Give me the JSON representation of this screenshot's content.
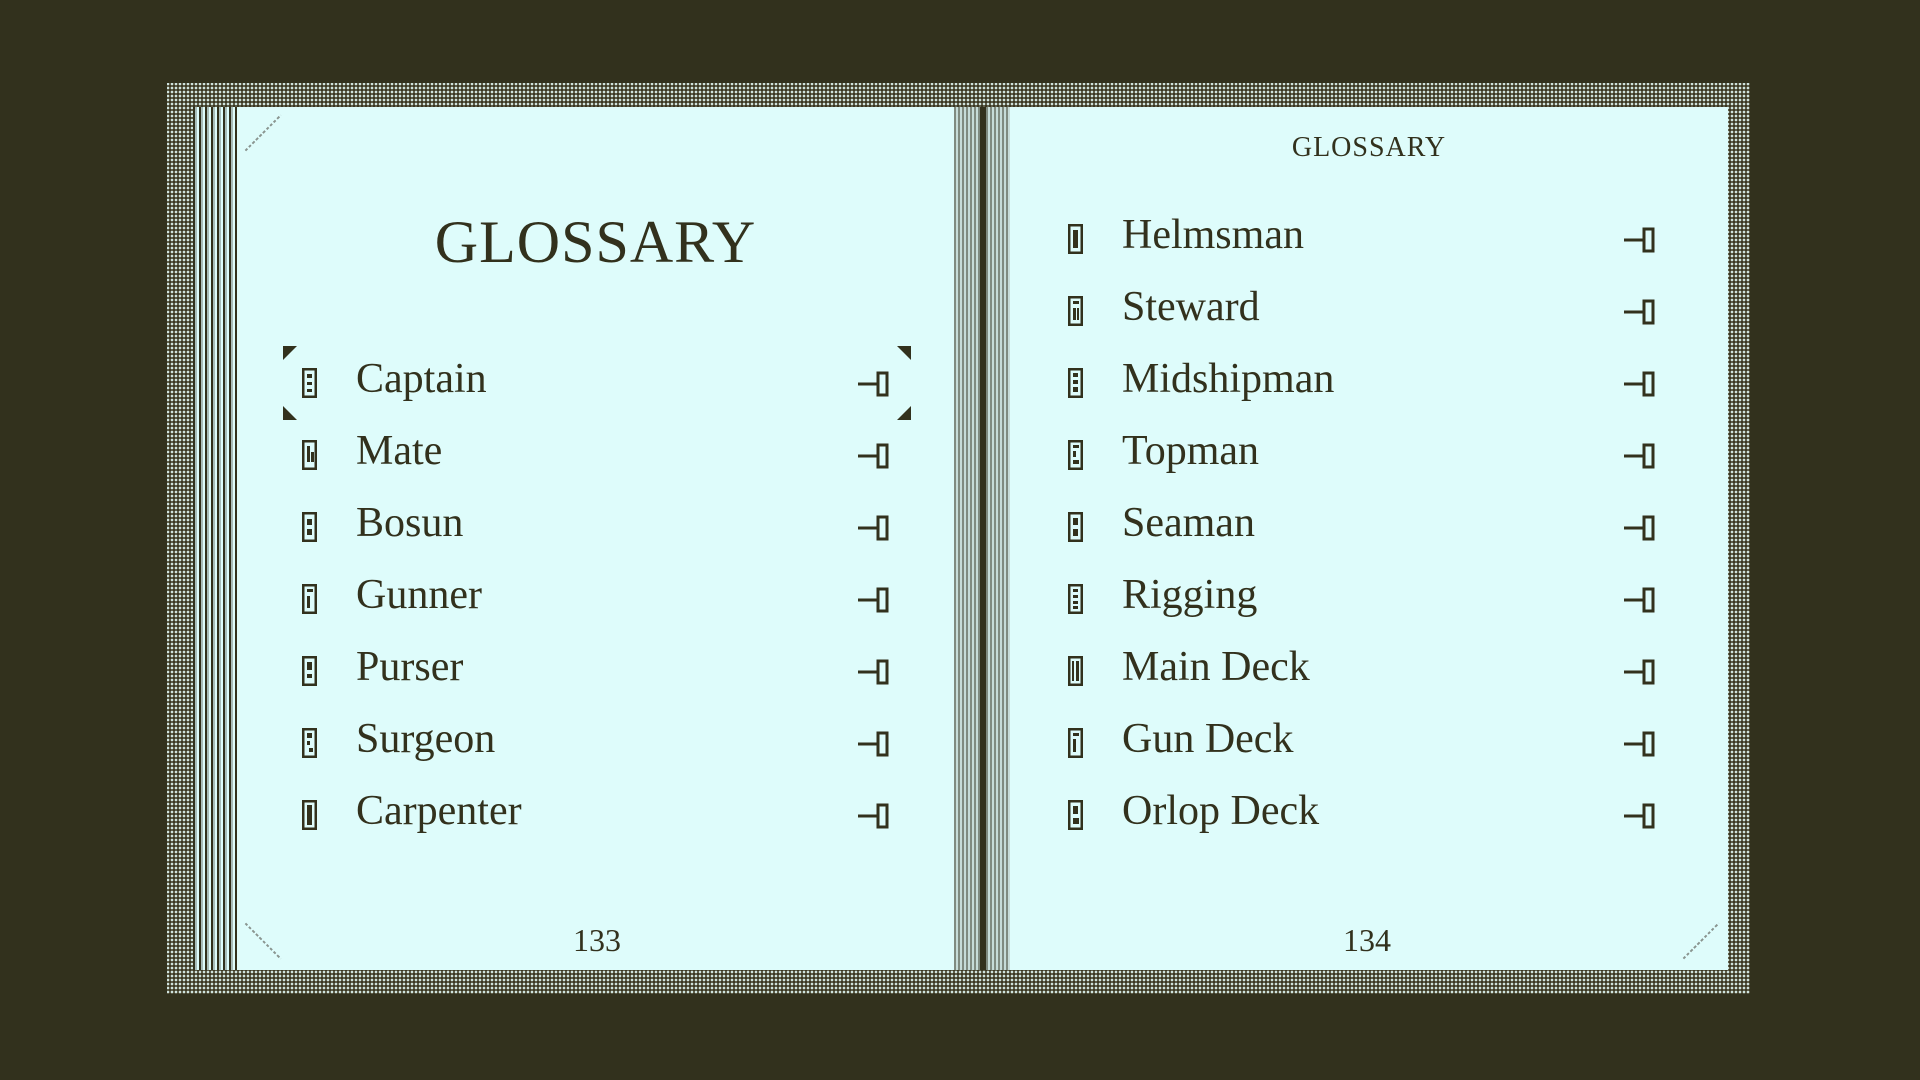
{
  "book": {
    "left_page": {
      "title": "GLOSSARY",
      "page_number": "133",
      "entries": [
        {
          "label": "Captain",
          "selected": true
        },
        {
          "label": "Mate"
        },
        {
          "label": "Bosun"
        },
        {
          "label": "Gunner"
        },
        {
          "label": "Purser"
        },
        {
          "label": "Surgeon"
        },
        {
          "label": "Carpenter"
        }
      ]
    },
    "right_page": {
      "header": "GLOSSARY",
      "page_number": "134",
      "entries": [
        {
          "label": "Helmsman"
        },
        {
          "label": "Steward"
        },
        {
          "label": "Midshipman"
        },
        {
          "label": "Topman"
        },
        {
          "label": "Seaman"
        },
        {
          "label": "Rigging"
        },
        {
          "label": "Main Deck"
        },
        {
          "label": "Gun Deck"
        },
        {
          "label": "Orlop Deck"
        }
      ]
    }
  },
  "icons": {
    "entry_marker": "glyph-marker-icon",
    "entry_link": "arrow-link-icon"
  },
  "colors": {
    "background": "#32311d",
    "page": "#defcfb",
    "ink": "#32311d"
  }
}
